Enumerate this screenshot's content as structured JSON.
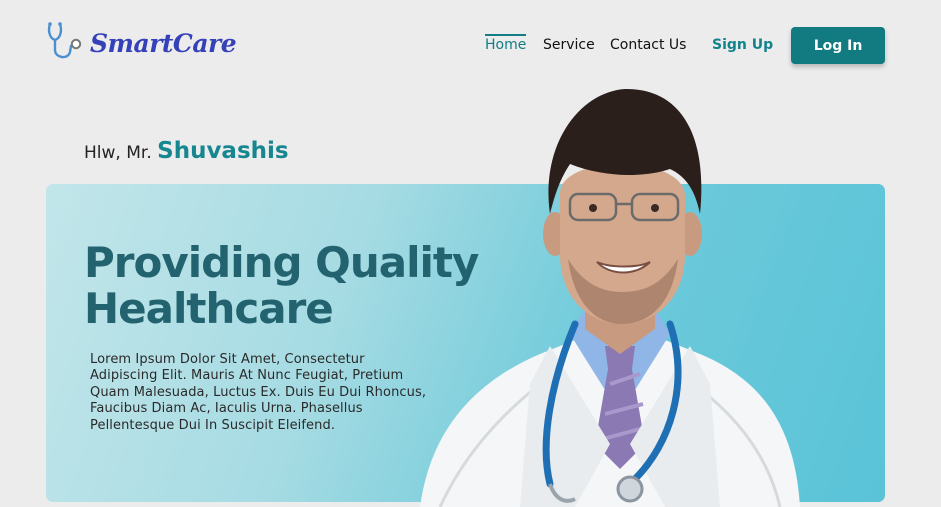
{
  "brand": {
    "name": "SmartCare",
    "logo_icon": "stethoscope-icon",
    "color": "#3441b8"
  },
  "nav": {
    "items": [
      {
        "label": "Home",
        "active": true
      },
      {
        "label": "Service",
        "active": false
      },
      {
        "label": "Contact Us",
        "active": false
      }
    ],
    "signup_label": "Sign Up",
    "login_label": "Log In"
  },
  "greeting": {
    "prefix": "Hlw, Mr.",
    "name": "Shuvashis"
  },
  "hero": {
    "title_line1": "Providing Quality",
    "title_line2": "Healthcare",
    "description": "Lorem Ipsum Dolor Sit Amet, Consectetur Adipiscing Elit. Mauris At Nunc Feugiat, Pretium Quam Malesuada, Luctus Ex. Duis Eu Dui Rhoncus, Faucibus Diam Ac, Iaculis Urna. Phasellus Pellentesque Dui In Suscipit Eleifend."
  },
  "colors": {
    "accent": "#127b82",
    "hero_title": "#23636f",
    "background": "#ececec"
  }
}
